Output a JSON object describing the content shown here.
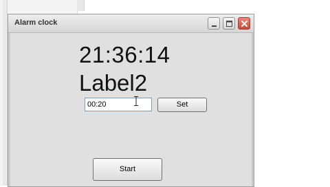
{
  "window": {
    "title": "Alarm clock"
  },
  "clock": {
    "time": "21:36:14",
    "label2": "Label2"
  },
  "alarm": {
    "value": "00:20"
  },
  "buttons": {
    "set_label": "Set",
    "start_label": "Start"
  },
  "icons": {
    "minimize": "minimize-icon",
    "maximize": "maximize-icon",
    "close": "close-icon",
    "cursor": "text-cursor-icon"
  },
  "colors": {
    "close_button": "#c84a3a",
    "client_bg": "#e0e0e0"
  }
}
